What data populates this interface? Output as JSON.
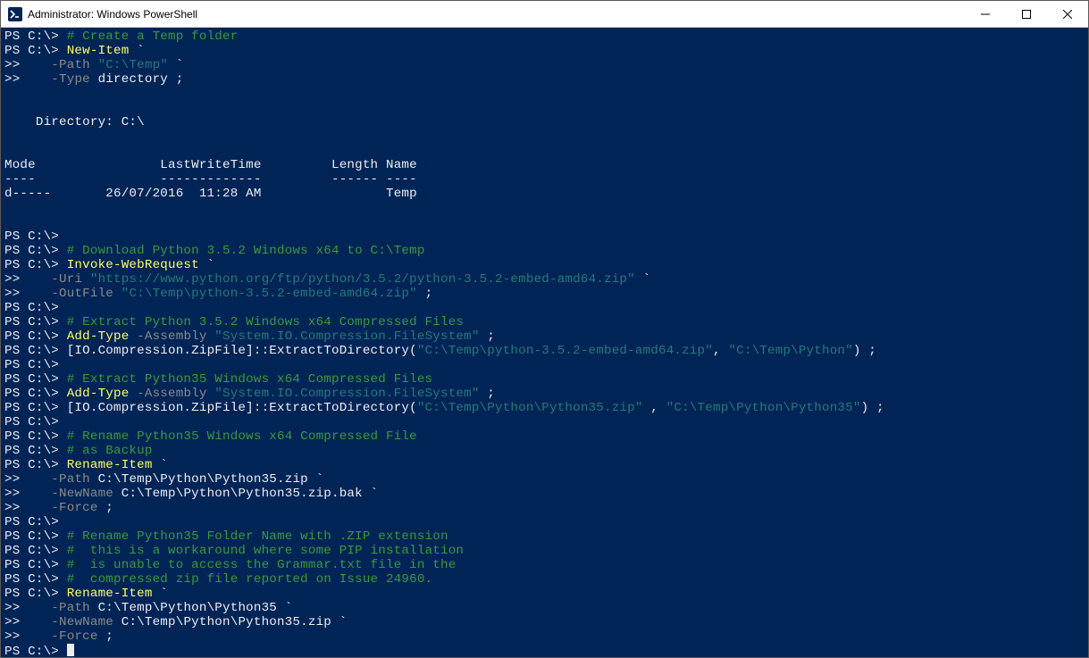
{
  "window": {
    "title": "Administrator: Windows PowerShell"
  },
  "lines": [
    [
      [
        "prompt",
        "PS C:\\> "
      ],
      [
        "comm",
        "# Create a Temp folder"
      ]
    ],
    [
      [
        "prompt",
        "PS C:\\> "
      ],
      [
        "cmd",
        "New-Item "
      ],
      [
        "white",
        "`"
      ]
    ],
    [
      [
        "cont",
        ">>    "
      ],
      [
        "param",
        "-Path "
      ],
      [
        "str",
        "\"C:\\Temp\" "
      ],
      [
        "white",
        "`"
      ]
    ],
    [
      [
        "cont",
        ">>    "
      ],
      [
        "param",
        "-Type "
      ],
      [
        "white",
        "directory ;"
      ]
    ],
    [
      [
        "white",
        ""
      ]
    ],
    [
      [
        "white",
        ""
      ]
    ],
    [
      [
        "white",
        "    Directory: C:\\"
      ]
    ],
    [
      [
        "white",
        ""
      ]
    ],
    [
      [
        "white",
        ""
      ]
    ],
    [
      [
        "white",
        "Mode                LastWriteTime         Length Name"
      ]
    ],
    [
      [
        "white",
        "----                -------------         ------ ----"
      ]
    ],
    [
      [
        "white",
        "d-----       26/07/2016  11:28 AM                Temp"
      ]
    ],
    [
      [
        "white",
        ""
      ]
    ],
    [
      [
        "white",
        ""
      ]
    ],
    [
      [
        "prompt",
        "PS C:\\>"
      ]
    ],
    [
      [
        "prompt",
        "PS C:\\> "
      ],
      [
        "comm",
        "# Download Python 3.5.2 Windows x64 to C:\\Temp"
      ]
    ],
    [
      [
        "prompt",
        "PS C:\\> "
      ],
      [
        "cmd",
        "Invoke-WebRequest "
      ],
      [
        "white",
        "`"
      ]
    ],
    [
      [
        "cont",
        ">>    "
      ],
      [
        "param",
        "-Uri "
      ],
      [
        "str",
        "\"https://www.python.org/ftp/python/3.5.2/python-3.5.2-embed-amd64.zip\" "
      ],
      [
        "white",
        "`"
      ]
    ],
    [
      [
        "cont",
        ">>    "
      ],
      [
        "param",
        "-OutFile "
      ],
      [
        "str",
        "\"C:\\Temp\\python-3.5.2-embed-amd64.zip\""
      ],
      [
        "white",
        " ;"
      ]
    ],
    [
      [
        "prompt",
        "PS C:\\>"
      ]
    ],
    [
      [
        "prompt",
        "PS C:\\> "
      ],
      [
        "comm",
        "# Extract Python 3.5.2 Windows x64 Compressed Files"
      ]
    ],
    [
      [
        "prompt",
        "PS C:\\> "
      ],
      [
        "cmd",
        "Add-Type "
      ],
      [
        "param",
        "-Assembly "
      ],
      [
        "str",
        "\"System.IO.Compression.FileSystem\""
      ],
      [
        "white",
        " ;"
      ]
    ],
    [
      [
        "prompt",
        "PS C:\\> "
      ],
      [
        "white",
        "[IO.Compression.ZipFile]::ExtractToDirectory("
      ],
      [
        "str",
        "\"C:\\Temp\\python-3.5.2-embed-amd64.zip\""
      ],
      [
        "white",
        ", "
      ],
      [
        "str",
        "\"C:\\Temp\\Python\""
      ],
      [
        "white",
        ") ;"
      ]
    ],
    [
      [
        "prompt",
        "PS C:\\>"
      ]
    ],
    [
      [
        "prompt",
        "PS C:\\> "
      ],
      [
        "comm",
        "# Extract Python35 Windows x64 Compressed Files"
      ]
    ],
    [
      [
        "prompt",
        "PS C:\\> "
      ],
      [
        "cmd",
        "Add-Type "
      ],
      [
        "param",
        "-Assembly "
      ],
      [
        "str",
        "\"System.IO.Compression.FileSystem\""
      ],
      [
        "white",
        " ;"
      ]
    ],
    [
      [
        "prompt",
        "PS C:\\> "
      ],
      [
        "white",
        "[IO.Compression.ZipFile]::ExtractToDirectory("
      ],
      [
        "str",
        "\"C:\\Temp\\Python\\Python35.zip\""
      ],
      [
        "white",
        " , "
      ],
      [
        "str",
        "\"C:\\Temp\\Python\\Python35\""
      ],
      [
        "white",
        ") ;"
      ]
    ],
    [
      [
        "prompt",
        "PS C:\\>"
      ]
    ],
    [
      [
        "prompt",
        "PS C:\\> "
      ],
      [
        "comm",
        "# Rename Python35 Windows x64 Compressed File"
      ]
    ],
    [
      [
        "prompt",
        "PS C:\\> "
      ],
      [
        "comm",
        "# as Backup"
      ]
    ],
    [
      [
        "prompt",
        "PS C:\\> "
      ],
      [
        "cmd",
        "Rename-Item "
      ],
      [
        "white",
        "`"
      ]
    ],
    [
      [
        "cont",
        ">>    "
      ],
      [
        "param",
        "-Path "
      ],
      [
        "white",
        "C:\\Temp\\Python\\Python35.zip `"
      ]
    ],
    [
      [
        "cont",
        ">>    "
      ],
      [
        "param",
        "-NewName "
      ],
      [
        "white",
        "C:\\Temp\\Python\\Python35.zip.bak `"
      ]
    ],
    [
      [
        "cont",
        ">>    "
      ],
      [
        "param",
        "-Force "
      ],
      [
        "white",
        ";"
      ]
    ],
    [
      [
        "prompt",
        "PS C:\\>"
      ]
    ],
    [
      [
        "prompt",
        "PS C:\\> "
      ],
      [
        "comm",
        "# Rename Python35 Folder Name with .ZIP extension"
      ]
    ],
    [
      [
        "prompt",
        "PS C:\\> "
      ],
      [
        "comm",
        "#  this is a workaround where some PIP installation"
      ]
    ],
    [
      [
        "prompt",
        "PS C:\\> "
      ],
      [
        "comm",
        "#  is unable to access the Grammar.txt file in the"
      ]
    ],
    [
      [
        "prompt",
        "PS C:\\> "
      ],
      [
        "comm",
        "#  compressed zip file reported on Issue 24960."
      ]
    ],
    [
      [
        "prompt",
        "PS C:\\> "
      ],
      [
        "cmd",
        "Rename-Item "
      ],
      [
        "white",
        "`"
      ]
    ],
    [
      [
        "cont",
        ">>    "
      ],
      [
        "param",
        "-Path "
      ],
      [
        "white",
        "C:\\Temp\\Python\\Python35 `"
      ]
    ],
    [
      [
        "cont",
        ">>    "
      ],
      [
        "param",
        "-NewName "
      ],
      [
        "white",
        "C:\\Temp\\Python\\Python35.zip `"
      ]
    ],
    [
      [
        "cont",
        ">>    "
      ],
      [
        "param",
        "-Force "
      ],
      [
        "white",
        ";"
      ]
    ],
    [
      [
        "prompt",
        "PS C:\\> "
      ],
      [
        "cursor",
        ""
      ]
    ]
  ]
}
